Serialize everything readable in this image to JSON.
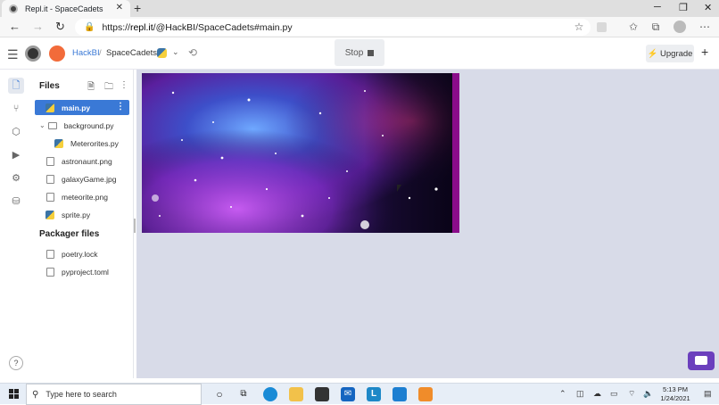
{
  "browser": {
    "tab_title": "Repl.it - SpaceCadets",
    "tab_close": "✕",
    "new_tab": "+",
    "url_prefix": "https://",
    "url_host": "repl.it",
    "url_path": "/@HackBI/SpaceCadets#main.py"
  },
  "header": {
    "owner": "HackBI",
    "separator": "/",
    "project": "SpaceCadets",
    "stop_label": "Stop",
    "upgrade_label": "Upgrade",
    "plus": "+"
  },
  "sidebar": {
    "files_title": "Files",
    "packager_title": "Packager files",
    "files": [
      {
        "name": "main.py",
        "type": "python",
        "selected": true
      },
      {
        "name": "background.py",
        "type": "folder"
      },
      {
        "name": "Meterorites.py",
        "type": "python"
      },
      {
        "name": "astronaunt.png",
        "type": "file"
      },
      {
        "name": "galaxyGame.jpg",
        "type": "file"
      },
      {
        "name": "meteorite.png",
        "type": "file"
      },
      {
        "name": "sprite.py",
        "type": "python"
      }
    ],
    "packager_files": [
      {
        "name": "poetry.lock"
      },
      {
        "name": "pyproject.toml"
      }
    ],
    "help": "?"
  },
  "taskbar": {
    "search_placeholder": "Type here to search",
    "time": "5:13 PM",
    "date": "1/24/2021"
  },
  "colors": {
    "accent": "#3a79d6",
    "chat_button": "#6b3fbd",
    "canvas_edge": "#8a0c8a"
  }
}
